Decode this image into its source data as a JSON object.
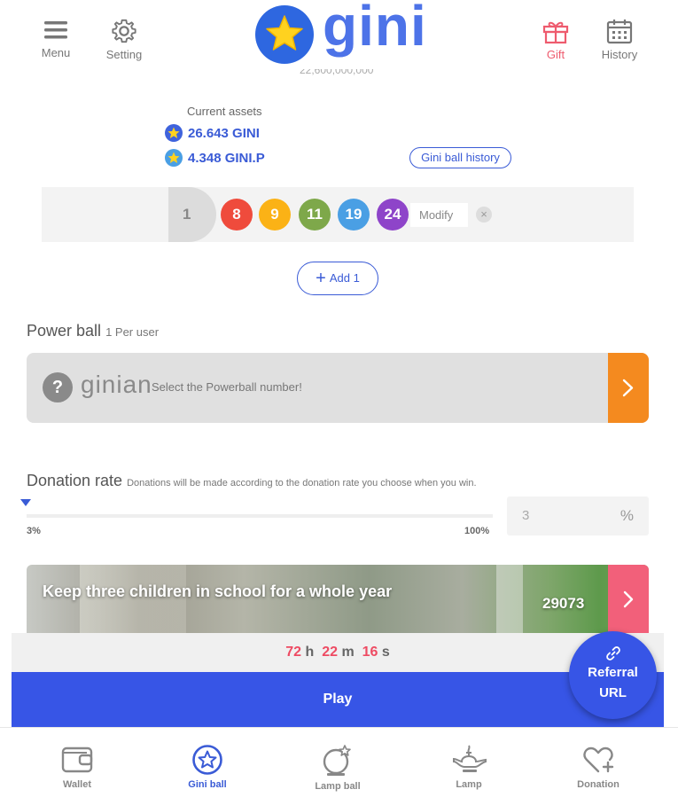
{
  "header": {
    "menu_label": "Menu",
    "setting_label": "Setting",
    "logo_text": "gini",
    "gift_label": "Gift",
    "history_label": "History",
    "cut_off_text": "22,600,000,000"
  },
  "assets": {
    "label": "Current assets",
    "gini": "26.643 GINI",
    "ginip": "4.348 GINI.P",
    "history_button": "Gini ball history"
  },
  "ball_row": {
    "index": "1",
    "numbers": [
      "8",
      "9",
      "11",
      "19",
      "24"
    ],
    "modify_label": "Modify",
    "clear_symbol": "×"
  },
  "add_button": "Add 1",
  "power_ball": {
    "title": "Power ball",
    "subtitle": "1 Per user",
    "brand": "ginian",
    "hint": "Select the Powerball number!"
  },
  "donation_rate": {
    "title": "Donation rate",
    "description": "Donations will be made according to the donation rate you choose when you win.",
    "min_label": "3%",
    "max_label": "100%",
    "value_fraction": 0.0,
    "input_value": "3",
    "unit": "%"
  },
  "donation_card": {
    "title": "Keep three children in school for a whole year",
    "count": "29073"
  },
  "timer": {
    "hours": "72",
    "h_unit": "h",
    "minutes": "22",
    "m_unit": "m",
    "seconds": "16",
    "s_unit": "s"
  },
  "play_button": "Play",
  "referral": {
    "line1": "Referral",
    "line2": "URL"
  },
  "bottom_nav": {
    "wallet": "Wallet",
    "gini_ball": "Gini ball",
    "lamp_ball": "Lamp ball",
    "lamp": "Lamp",
    "donation": "Donation"
  },
  "colors": {
    "primary": "#3755e6",
    "orange": "#f48a1f",
    "pink": "#f2607a",
    "ball_colors": [
      "#ef4b3c",
      "#fbb216",
      "#7ea84a",
      "#4a9fe4",
      "#8e44c9"
    ]
  }
}
